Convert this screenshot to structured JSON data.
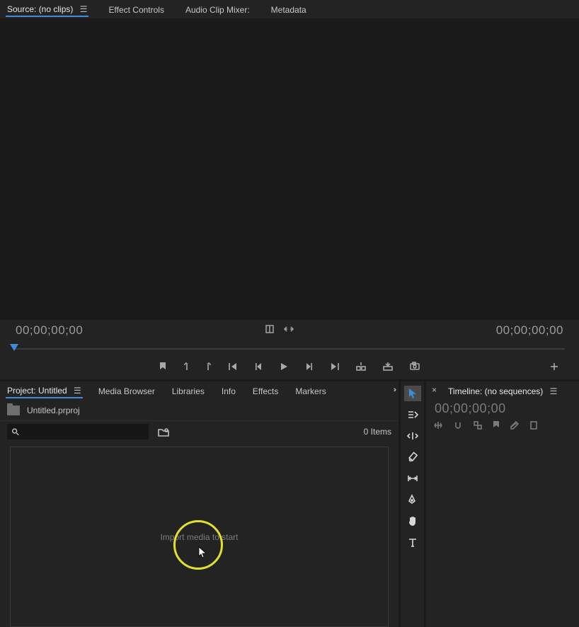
{
  "source": {
    "tabs": [
      {
        "label": "Source: (no clips)",
        "active": true
      },
      {
        "label": "Effect Controls",
        "active": false
      },
      {
        "label": "Audio Clip Mixer:",
        "active": false
      },
      {
        "label": "Metadata",
        "active": false
      }
    ],
    "timecode_left": "00;00;00;00",
    "timecode_right": "00;00;00;00"
  },
  "project": {
    "tabs": [
      {
        "label": "Project: Untitled",
        "active": true
      },
      {
        "label": "Media Browser",
        "active": false
      },
      {
        "label": "Libraries",
        "active": false
      },
      {
        "label": "Info",
        "active": false
      },
      {
        "label": "Effects",
        "active": false
      },
      {
        "label": "Markers",
        "active": false
      }
    ],
    "file_name": "Untitled.prproj",
    "search_placeholder": "",
    "items_count": "0 Items",
    "empty_hint": "Import media to start"
  },
  "tools": [
    {
      "name": "selection-tool",
      "active": true
    },
    {
      "name": "track-select-tool",
      "active": false
    },
    {
      "name": "ripple-edit-tool",
      "active": false
    },
    {
      "name": "razor-tool",
      "active": false
    },
    {
      "name": "slip-tool",
      "active": false
    },
    {
      "name": "pen-tool",
      "active": false
    },
    {
      "name": "hand-tool",
      "active": false
    },
    {
      "name": "type-tool",
      "active": false
    }
  ],
  "timeline": {
    "tab_label": "Timeline: (no sequences)",
    "timecode": "00;00;00;00"
  }
}
